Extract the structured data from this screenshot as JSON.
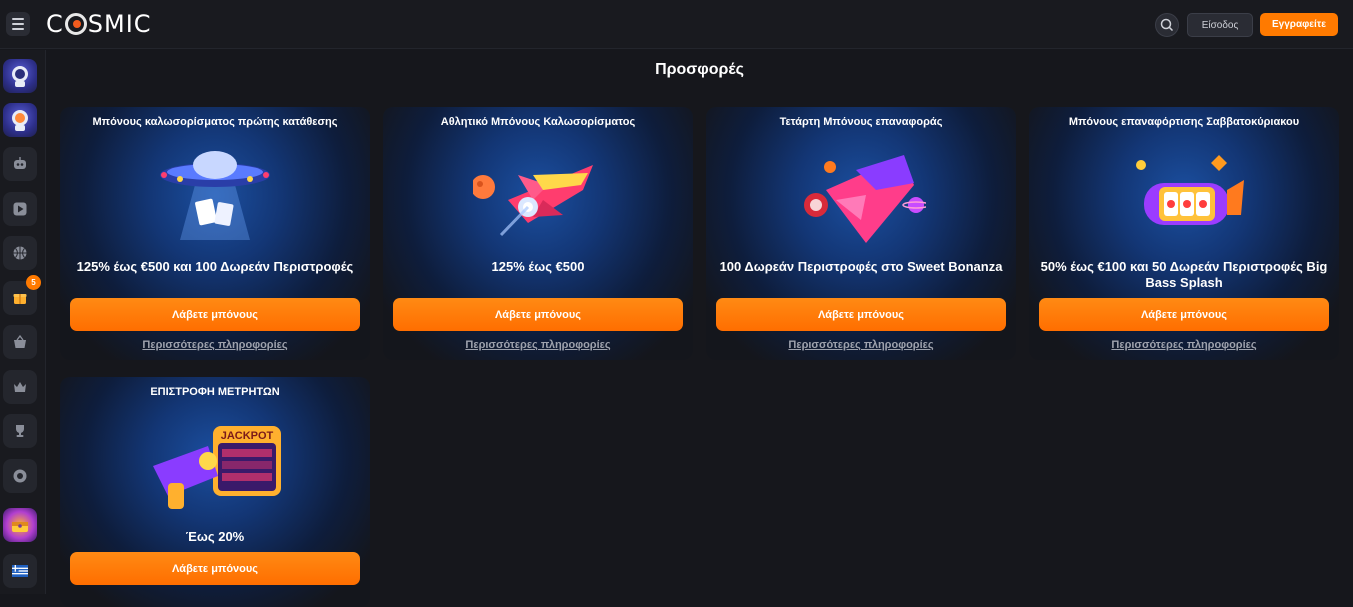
{
  "header": {
    "logo": "COSMIC",
    "logo_first": "C",
    "logo_rest": "SMIC",
    "login_label": "Είσοδος",
    "signup_label": "Εγγραφείτε"
  },
  "sidebar": {
    "badge_count": "5",
    "items": [
      {
        "icon": "astronaut-image"
      },
      {
        "icon": "astronaut-image"
      },
      {
        "icon": "robot-icon"
      },
      {
        "icon": "play-icon"
      },
      {
        "icon": "basketball-icon"
      },
      {
        "icon": "gift-icon"
      },
      {
        "icon": "basket-icon"
      },
      {
        "icon": "crown-icon"
      },
      {
        "icon": "trophy-icon"
      },
      {
        "icon": "chip-icon"
      },
      {
        "icon": "treasure-image"
      },
      {
        "icon": "greek-flag-icon"
      }
    ]
  },
  "main": {
    "title": "Προσφορές",
    "promos": [
      {
        "title": "Μπόνους καλωσορίσματος πρώτης κατάθεσης",
        "description": "125% έως €500 και 100 Δωρεάν Περιστροφές",
        "button_label": "Λάβετε μπόνους",
        "more_label": "Περισσότερες πληροφορίες",
        "art": "ufo-image"
      },
      {
        "title": "Αθλητικό Μπόνους Καλωσορίσματος",
        "description": "125% έως €500",
        "button_label": "Λάβετε μπόνους",
        "more_label": "Περισσότερες πληροφορίες",
        "art": "rocket-image"
      },
      {
        "title": "Τετάρτη Μπόνους επαναφοράς",
        "description": "100 Δωρεάν Περιστροφές στο Sweet Bonanza",
        "button_label": "Λάβετε μπόνους",
        "more_label": "Περισσότερες πληροφορίες",
        "art": "spaceship-image"
      },
      {
        "title": "Μπόνους επαναφόρτισης Σαββατοκύριακου",
        "description": "50% έως €100 και 50 Δωρεάν Περιστροφές Big Bass Splash",
        "button_label": "Λάβετε μπόνους",
        "more_label": "Περισσότερες πληροφορίες",
        "art": "slot-rocket-image"
      },
      {
        "title": "ΕΠΙΣΤΡΟΦΗ ΜΕΤΡΗΤΩΝ",
        "description": "Έως 20%",
        "button_label": "Λάβετε μπόνους",
        "art": "jackpot-gun-image",
        "art_text": "JACKPOT"
      }
    ]
  },
  "colors": {
    "accent": "#ff7a00",
    "background": "#16171c",
    "panel": "#191a1f"
  }
}
